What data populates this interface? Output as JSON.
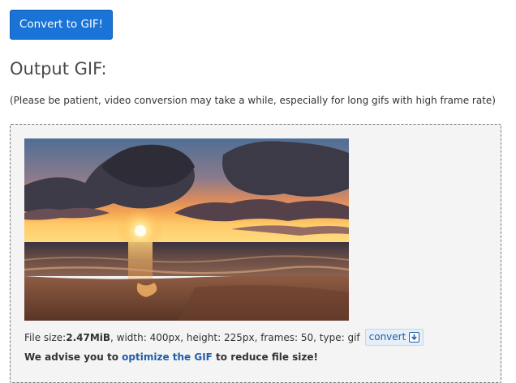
{
  "toolbar": {
    "convert_button_label": "Convert to GIF!"
  },
  "output": {
    "heading": "Output GIF:",
    "patience_note": "(Please be patient, video conversion may take a while, especially for long gifs with high frame rate)",
    "image_alt": "beach sunset with clouds over the ocean",
    "file_size_label": "File size: ",
    "file_size_value": "2.47MiB",
    "details": ", width: 400px, height: 225px, frames: 50, type: gif",
    "convert_link_label": "convert",
    "advise_prefix": "We advise you to ",
    "advise_link": "optimize the GIF",
    "advise_suffix": " to reduce file size!"
  },
  "colors": {
    "button_bg": "#1a73d6",
    "link": "#1f5ea8",
    "box_bg": "#f4f4f4"
  },
  "icons": {
    "download": "download-icon"
  }
}
